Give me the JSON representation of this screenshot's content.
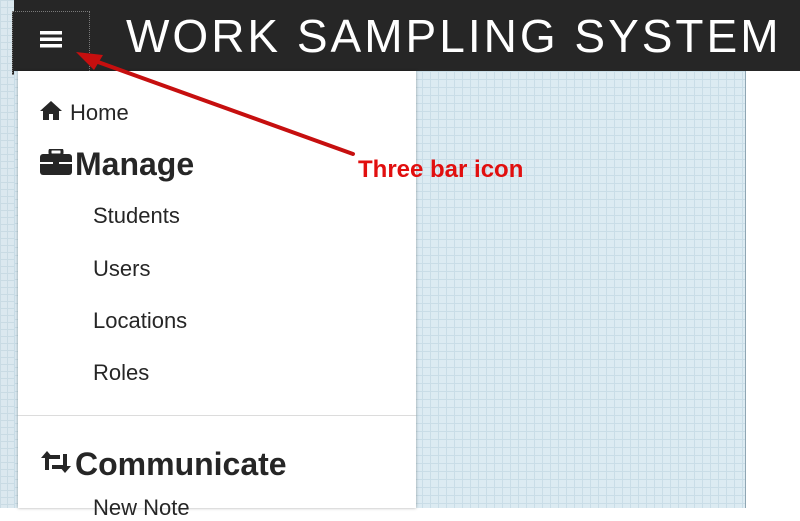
{
  "app": {
    "title": "WORK SAMPLING SYSTEM"
  },
  "menu": {
    "home_label": "Home",
    "manage": {
      "heading": "Manage",
      "items": [
        "Students",
        "Users",
        "Locations",
        "Roles"
      ]
    },
    "communicate": {
      "heading": "Communicate",
      "next_item_partial": "New Note"
    }
  },
  "annotation": {
    "text": "Three bar icon",
    "color": "#e10f0f"
  },
  "icons": {
    "menu_button": "three-bar-icon",
    "home": "home-icon",
    "manage": "briefcase-icon",
    "communicate": "retweet-icon"
  },
  "colors": {
    "topbar": "#262626",
    "content_background": "#dcebf2"
  }
}
